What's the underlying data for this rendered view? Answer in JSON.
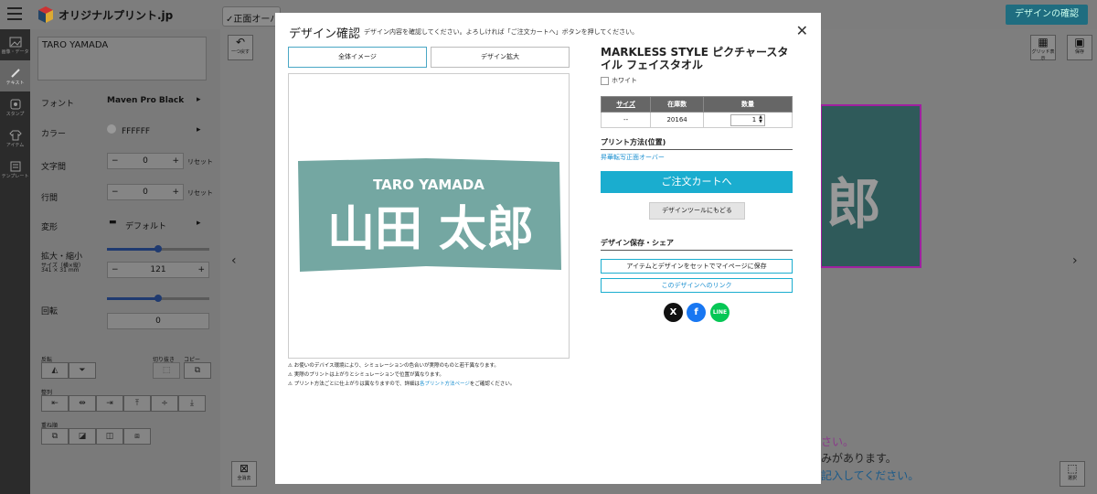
{
  "app": {
    "logo_text": "オリジナルプリント.jp",
    "tab_chip": "正面オーバ",
    "confirm_button": "デザインの確認"
  },
  "rail": [
    {
      "label": "画像・データ",
      "icon": "image-icon"
    },
    {
      "label": "テキスト",
      "icon": "pencil-icon"
    },
    {
      "label": "スタンプ",
      "icon": "stamp-icon"
    },
    {
      "label": "アイテム",
      "icon": "shirt-icon"
    },
    {
      "label": "テンプレート",
      "icon": "template-icon"
    }
  ],
  "panel": {
    "text_value": "TARO YAMADA",
    "font_label": "フォント",
    "font_value": "Maven Pro Black",
    "color_label": "カラー",
    "color_value": "FFFFFF",
    "spacing_label": "文字間",
    "spacing_value": "0",
    "line_label": "行間",
    "line_value": "0",
    "reset_label": "リセット",
    "transform_label": "変形",
    "transform_value": "デフォルト",
    "scale_label": "拡大・縮小",
    "size_label": "サイズ（横×縦）",
    "size_value": "341 × 31 mm",
    "scale_value": "121",
    "scale_slider": 0.5,
    "rotate_label": "回転",
    "rotate_value": "0",
    "rotate_slider": 0.5,
    "flip_label": "反転",
    "crop_label": "切り抜き",
    "copy_label": "コピー",
    "align_label": "整列",
    "order_label": "重ね順"
  },
  "canvas": {
    "undo_label": "一つ戻す",
    "grid_label": "グリッド表示",
    "save_label": "保存",
    "delete_all_label": "全消去",
    "select_label": "選択",
    "kanji": "郎",
    "text1": "さい。",
    "text2": "みがあります。",
    "text3": "記入してください。"
  },
  "modal": {
    "title": "デザイン確認",
    "subtitle": "デザイン内容を確認してください。よろしければ「ご注文カートへ」ボタンを押してください。",
    "tab_full": "全体イメージ",
    "tab_zoom": "デザイン拡大",
    "preview_name": "TARO YAMADA",
    "preview_kanji": "山田 太郎",
    "notes": [
      "お使いのデバイス環境により、シミュレーションの色合いが実際のものと若干異なります。",
      "実際のプリントは上がりとシミュレーションで位置が異なります。",
      "プリント方法ごとに仕上がりは異なりますので、詳細は"
    ],
    "notes_link": "各プリント方法ページ",
    "notes_tail": "をご確認ください。",
    "product_title": "MARKLESS STYLE ピクチャースタイル フェイスタオル",
    "color_name": "ホワイト",
    "table_headers": [
      "サイズ",
      "在庫数",
      "数量"
    ],
    "table_row": [
      "--",
      "20164",
      "1"
    ],
    "print_method_heading": "プリント方法(位置)",
    "print_method_link": "昇華転写正面オーバー",
    "cart_button": "ご注文カートへ",
    "back_button": "デザインツールにもどる",
    "save_share_heading": "デザイン保存・シェア",
    "save_mypage_button": "アイテムとデザインをセットでマイページに保存",
    "design_link_button": "このデザインへのリンク",
    "social": [
      "X",
      "f",
      "LINE"
    ]
  },
  "colors": {
    "accent": "#1aadcf",
    "towel": "#74a7a2",
    "link": "#1a8fd0"
  }
}
